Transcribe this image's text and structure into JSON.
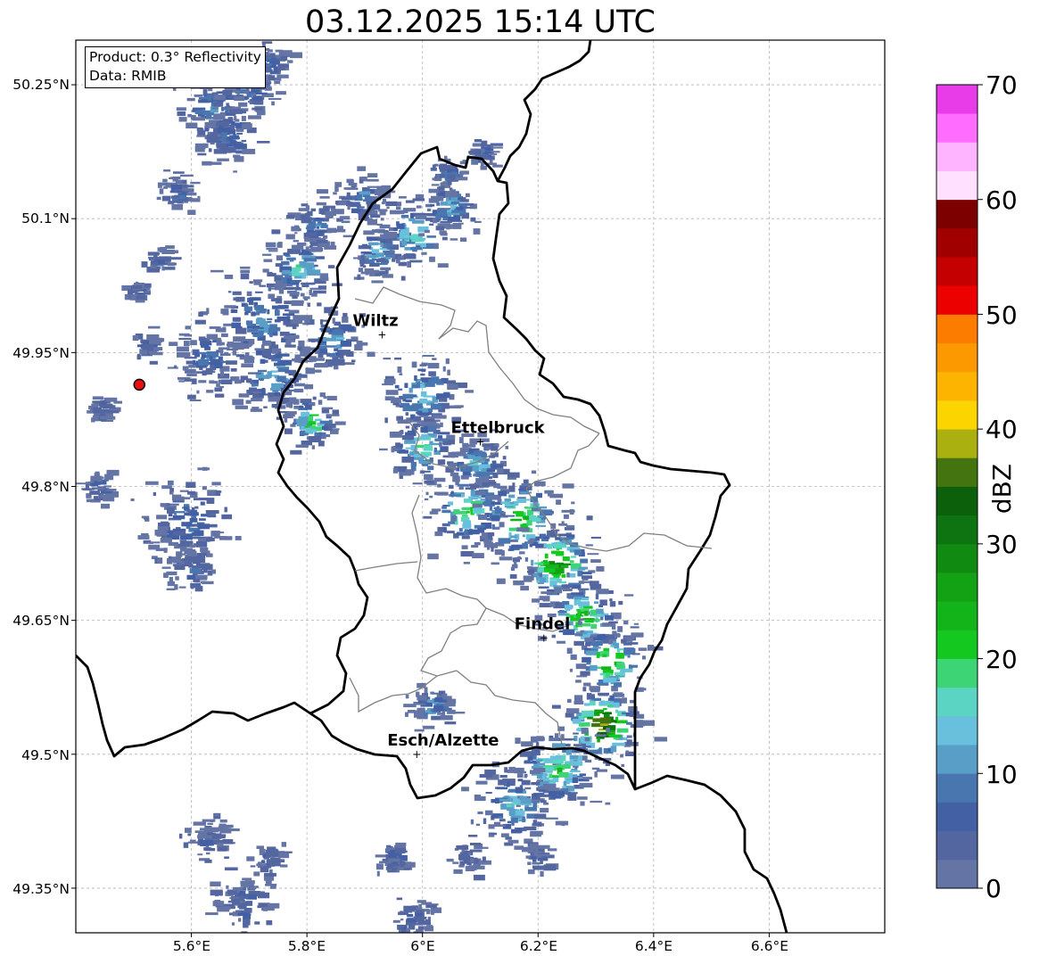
{
  "title": "03.12.2025 15:14 UTC",
  "info": {
    "product": "Product: 0.3° Reflectivity",
    "source": "Data: RMIB"
  },
  "axes": {
    "lon_range": [
      5.4,
      6.8
    ],
    "lat_range": [
      49.3,
      50.3
    ],
    "x_ticks": [
      "5.6°E",
      "5.8°E",
      "6°E",
      "6.2°E",
      "6.4°E",
      "6.6°E"
    ],
    "y_ticks": [
      "50.25°N",
      "50.1°N",
      "49.95°N",
      "49.8°N",
      "49.65°N",
      "49.5°N",
      "49.35°N"
    ],
    "grid": true
  },
  "colorbar": {
    "label": "dBZ",
    "tick_labels": [
      "70",
      "60",
      "50",
      "40",
      "30",
      "20",
      "10",
      "0"
    ],
    "range": [
      0,
      70
    ],
    "step": 2.5,
    "colors": [
      "#6474a4",
      "#5466a0",
      "#4460a4",
      "#4a76b0",
      "#589ec6",
      "#68c0dc",
      "#5cd4c4",
      "#3cd474",
      "#14c820",
      "#12b41a",
      "#12a214",
      "#108a10",
      "#0e7412",
      "#0c600c",
      "#447410",
      "#aab010",
      "#fcd400",
      "#fcb400",
      "#fc9800",
      "#fc7c00",
      "#ec0000",
      "#c40000",
      "#a00000",
      "#7c0000",
      "#ffe0ff",
      "#ffb4ff",
      "#ff6cff",
      "#e83ce8"
    ]
  },
  "places": [
    {
      "name": "Wiltz",
      "lon": 5.93,
      "lat": 49.97
    },
    {
      "name": "Ettelbruck",
      "lon": 6.1,
      "lat": 49.85
    },
    {
      "name": "Findel",
      "lon": 6.21,
      "lat": 49.63
    },
    {
      "name": "Esch/Alzette",
      "lon": 5.99,
      "lat": 49.5
    }
  ],
  "radar_site": {
    "lon": 5.51,
    "lat": 49.914
  },
  "legend_text": {}
}
